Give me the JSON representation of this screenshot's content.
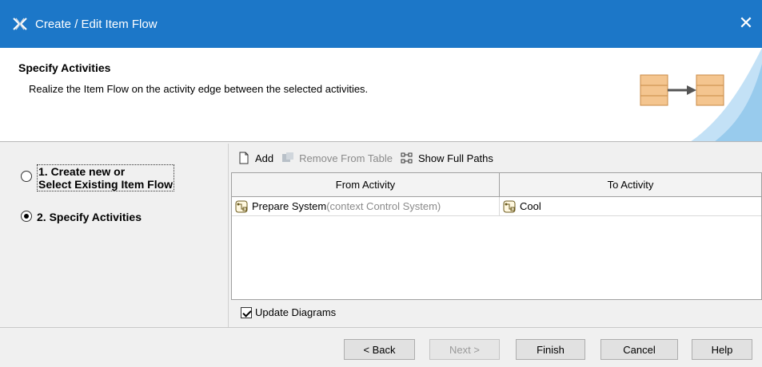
{
  "window": {
    "title": "Create / Edit Item Flow",
    "close_glyph": "✕",
    "app_icon": "magicdraw-icon"
  },
  "header": {
    "title": "Specify Activities",
    "description": "Realize the Item Flow on the activity edge between the selected activities.",
    "illustration": "activity-flow-icon"
  },
  "steps": [
    {
      "label": "1. Create new or Select Existing Item Flow",
      "line1": "1. Create new or",
      "line2": "Select Existing Item Flow",
      "selected": false
    },
    {
      "label": "2. Specify Activities",
      "selected": true
    }
  ],
  "toolbar": {
    "add_label": "Add",
    "remove_label": "Remove From Table",
    "show_paths_label": "Show Full Paths"
  },
  "table": {
    "columns": [
      "From Activity",
      "To Activity"
    ],
    "rows": [
      {
        "from_name": "Prepare System",
        "from_context": "(context Control System)",
        "to_name": "Cool"
      }
    ]
  },
  "options": {
    "update_diagrams_label": "Update Diagrams",
    "update_diagrams_checked": true
  },
  "buttons": {
    "back": "< Back",
    "next": "Next >",
    "finish": "Finish",
    "cancel": "Cancel",
    "help": "Help"
  },
  "colors": {
    "titlebar": "#1c77c8",
    "header_accent": "#a9d4f2",
    "icon_orange": "#f4c58f"
  }
}
